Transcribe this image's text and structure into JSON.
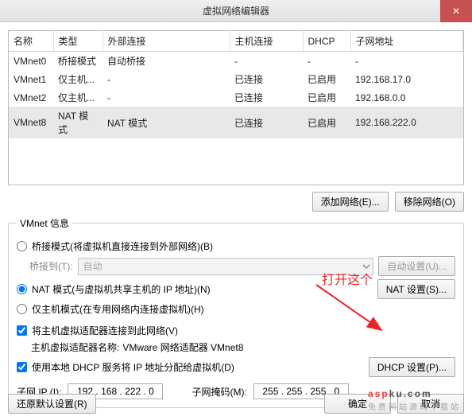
{
  "window": {
    "title": "虚拟网络编辑器",
    "close": "✕"
  },
  "table": {
    "headers": [
      "名称",
      "类型",
      "外部连接",
      "主机连接",
      "DHCP",
      "子网地址"
    ],
    "rows": [
      {
        "c": [
          "VMnet0",
          "桥接模式",
          "自动桥接",
          "-",
          "-",
          "-"
        ],
        "sel": false
      },
      {
        "c": [
          "VMnet1",
          "仅主机...",
          "-",
          "已连接",
          "已启用",
          "192.168.17.0"
        ],
        "sel": false
      },
      {
        "c": [
          "VMnet2",
          "仅主机...",
          "-",
          "已连接",
          "已启用",
          "192.168.0.0"
        ],
        "sel": false
      },
      {
        "c": [
          "VMnet8",
          "NAT 模式",
          "NAT 模式",
          "已连接",
          "已启用",
          "192.168.222.0"
        ],
        "sel": true
      }
    ]
  },
  "buttons": {
    "add_net": "添加网络(E)...",
    "remove_net": "移除网络(O)",
    "auto_set": "自动设置(U)...",
    "nat_set": "NAT 设置(S)...",
    "dhcp_set": "DHCP 设置(P)...",
    "restore": "还原默认设置(R)",
    "ok": "确定",
    "cancel": "取消"
  },
  "fieldset": {
    "legend": "VMnet 信息",
    "radio_bridge": "桥接模式(将虚拟机直接连接到外部网络)(B)",
    "bridge_to_label": "桥接到(T):",
    "bridge_to_value": "自动",
    "radio_nat": "NAT 模式(与虚拟机共享主机的 IP 地址)(N)",
    "radio_host": "仅主机模式(在专用网络内连接虚拟机)(H)",
    "chk_host_adapter": "将主机虚拟适配器连接到此网络(V)",
    "host_adapter_name_label": "主机虚拟适配器名称:",
    "host_adapter_name": "VMware 网络适配器 VMnet8",
    "chk_dhcp": "使用本地 DHCP 服务将 IP 地址分配给虚拟机(D)",
    "subnet_ip_label": "子网 IP (I):",
    "subnet_ip": "192 . 168 . 222 .  0",
    "subnet_mask_label": "子网掩码(M):",
    "subnet_mask": "255 . 255 . 255 .  0"
  },
  "annotation": {
    "text": "打开这个"
  },
  "watermark": {
    "main_a": "asp",
    "main_b": "ku",
    "dot": ".com",
    "sub": "免费网站源码下载站"
  }
}
